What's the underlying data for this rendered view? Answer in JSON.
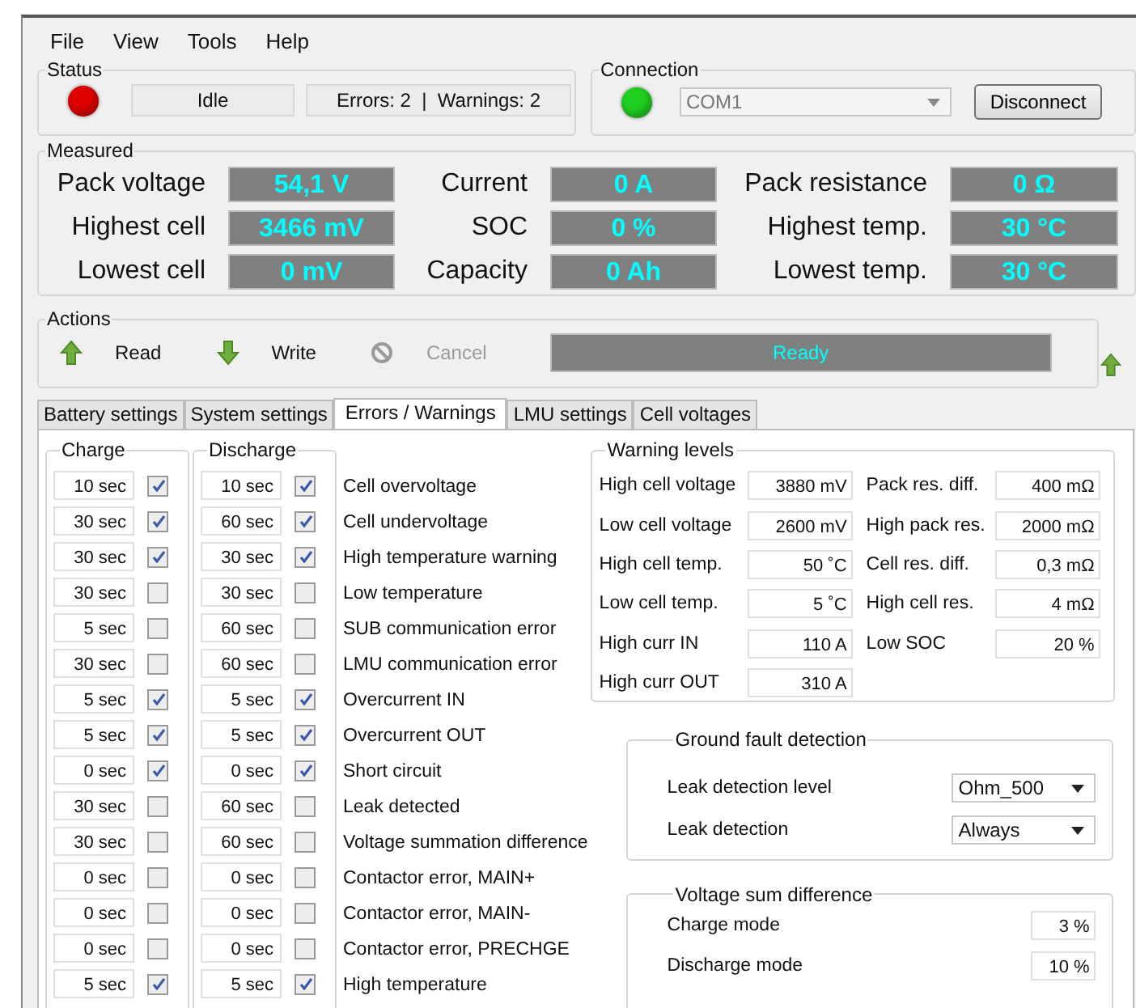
{
  "menu": [
    "File",
    "View",
    "Tools",
    "Help"
  ],
  "status": {
    "title": "Status",
    "indicator": {
      "color": "#e00000"
    },
    "state": "Idle",
    "summary": "Errors: 2  |  Warnings: 2"
  },
  "connection": {
    "title": "Connection",
    "indicator": {
      "color": "#20d020"
    },
    "port": "COM1",
    "button": "Disconnect"
  },
  "measured": {
    "title": "Measured",
    "items": [
      {
        "label": "Pack voltage",
        "value": "54,1 V"
      },
      {
        "label": "Current",
        "value": "0 A"
      },
      {
        "label": "Pack resistance",
        "value": "0 Ω"
      },
      {
        "label": "Highest cell",
        "value": "3466 mV"
      },
      {
        "label": "SOC",
        "value": "0 %"
      },
      {
        "label": "Highest temp.",
        "value": "30 °C"
      },
      {
        "label": "Lowest cell",
        "value": "0 mV"
      },
      {
        "label": "Capacity",
        "value": "0 Ah"
      },
      {
        "label": "Lowest temp.",
        "value": "30 °C"
      }
    ]
  },
  "actions": {
    "title": "Actions",
    "buttons": [
      {
        "label": "Read",
        "kind": "up",
        "disabled": false
      },
      {
        "label": "Write",
        "kind": "down",
        "disabled": false
      },
      {
        "label": "Cancel",
        "kind": "cancel",
        "disabled": true
      }
    ],
    "progress_text": "Ready"
  },
  "tabs": [
    {
      "label": "Battery settings",
      "selected": false
    },
    {
      "label": "System settings",
      "selected": false
    },
    {
      "label": "Errors / Warnings",
      "selected": true
    },
    {
      "label": "LMU settings",
      "selected": false
    },
    {
      "label": "Cell voltages",
      "selected": false
    }
  ],
  "errors": {
    "charge_title": "Charge",
    "discharge_title": "Discharge",
    "rows": [
      {
        "label": "Cell overvoltage",
        "charge": {
          "time": "10 sec",
          "checked": true
        },
        "discharge": {
          "time": "10 sec",
          "checked": true
        }
      },
      {
        "label": "Cell undervoltage",
        "charge": {
          "time": "30 sec",
          "checked": true
        },
        "discharge": {
          "time": "60 sec",
          "checked": true
        }
      },
      {
        "label": "High temperature warning",
        "charge": {
          "time": "30 sec",
          "checked": true
        },
        "discharge": {
          "time": "30 sec",
          "checked": true
        }
      },
      {
        "label": "Low temperature",
        "charge": {
          "time": "30 sec",
          "checked": false
        },
        "discharge": {
          "time": "30 sec",
          "checked": false
        }
      },
      {
        "label": "SUB communication error",
        "charge": {
          "time": "5 sec",
          "checked": false
        },
        "discharge": {
          "time": "60 sec",
          "checked": false
        }
      },
      {
        "label": "LMU communication error",
        "charge": {
          "time": "30 sec",
          "checked": false
        },
        "discharge": {
          "time": "60 sec",
          "checked": false
        }
      },
      {
        "label": "Overcurrent IN",
        "charge": {
          "time": "5 sec",
          "checked": true
        },
        "discharge": {
          "time": "5 sec",
          "checked": true
        }
      },
      {
        "label": "Overcurrent OUT",
        "charge": {
          "time": "5 sec",
          "checked": true
        },
        "discharge": {
          "time": "5 sec",
          "checked": true
        }
      },
      {
        "label": "Short circuit",
        "charge": {
          "time": "0 sec",
          "checked": true
        },
        "discharge": {
          "time": "0 sec",
          "checked": true
        }
      },
      {
        "label": "Leak detected",
        "charge": {
          "time": "30 sec",
          "checked": false
        },
        "discharge": {
          "time": "60 sec",
          "checked": false
        }
      },
      {
        "label": "Voltage summation difference",
        "charge": {
          "time": "30 sec",
          "checked": false
        },
        "discharge": {
          "time": "60 sec",
          "checked": false
        }
      },
      {
        "label": "Contactor error, MAIN+",
        "charge": {
          "time": "0 sec",
          "checked": false
        },
        "discharge": {
          "time": "0 sec",
          "checked": false
        }
      },
      {
        "label": "Contactor error, MAIN-",
        "charge": {
          "time": "0 sec",
          "checked": false
        },
        "discharge": {
          "time": "0 sec",
          "checked": false
        }
      },
      {
        "label": "Contactor error, PRECHGE",
        "charge": {
          "time": "0 sec",
          "checked": false
        },
        "discharge": {
          "time": "0 sec",
          "checked": false
        }
      },
      {
        "label": "High temperature",
        "charge": {
          "time": "5 sec",
          "checked": true
        },
        "discharge": {
          "time": "5 sec",
          "checked": true
        }
      }
    ]
  },
  "warning_levels": {
    "title": "Warning levels",
    "left": [
      {
        "label": "High cell voltage",
        "value": "3880 mV"
      },
      {
        "label": "Low cell voltage",
        "value": "2600 mV"
      },
      {
        "label": "High cell temp.",
        "value": "50 ˚C"
      },
      {
        "label": "Low cell temp.",
        "value": "5 ˚C"
      },
      {
        "label": "High curr IN",
        "value": "110 A"
      },
      {
        "label": "High curr OUT",
        "value": "310 A"
      }
    ],
    "right": [
      {
        "label": "Pack res. diff.",
        "value": "400 mΩ"
      },
      {
        "label": "High pack res.",
        "value": "2000 mΩ"
      },
      {
        "label": "Cell res. diff.",
        "value": "0,3 mΩ"
      },
      {
        "label": "High cell res.",
        "value": "4 mΩ"
      },
      {
        "label": "Low SOC",
        "value": "20 %"
      }
    ]
  },
  "ground_fault": {
    "title": "Ground fault detection",
    "rows": [
      {
        "label": "Leak detection level",
        "value": "Ohm_500"
      },
      {
        "label": "Leak detection",
        "value": "Always"
      }
    ]
  },
  "voltage_sum": {
    "title": "Voltage sum difference",
    "rows": [
      {
        "label": "Charge mode",
        "value": "3 %"
      },
      {
        "label": "Discharge mode",
        "value": "10 %"
      }
    ]
  }
}
